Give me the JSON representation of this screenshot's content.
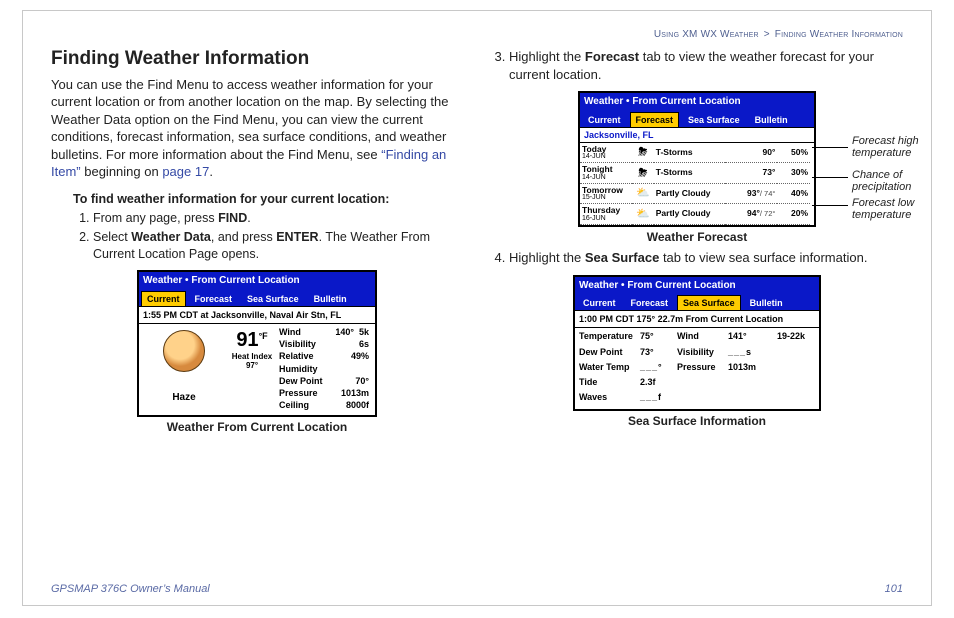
{
  "breadcrumb": {
    "section": "Using XM WX Weather",
    "sep": ">",
    "sub": "Finding Weather Information"
  },
  "heading": "Finding Weather Information",
  "intro_before_link": "You can use the Find Menu to access weather information for your current location or from another location on the map. By selecting the Weather Data option on the Find Menu, you can view the current conditions, forecast information, sea surface conditions, and weather bulletins. For more information about the Find Menu, see ",
  "link_text": "“Finding an Item”",
  "intro_mid": " beginning on ",
  "page_ref": "page 17",
  "intro_after": ".",
  "subhead1": "To find weather information for your current location:",
  "step1_a": "From any page, press ",
  "step1_b": "FIND",
  "step1_c": ".",
  "step2_a": "Select ",
  "step2_b": "Weather Data",
  "step2_c": ", and press ",
  "step2_d": "ENTER",
  "step2_e": ". The Weather From Current Location Page opens.",
  "current": {
    "title": "Weather • From Current Location",
    "tabs": {
      "current": "Current",
      "forecast": "Forecast",
      "sea": "Sea Surface",
      "bulletin": "Bulletin"
    },
    "status": "1:55 PM CDT at Jacksonville, Naval Air Stn, FL",
    "temp": "91",
    "temp_unit": "°F",
    "heat_index_label": "Heat Index",
    "heat_index_value": "97°",
    "condition": "Haze",
    "rows": [
      {
        "label": "Wind",
        "val": "140°",
        "extra": "5k"
      },
      {
        "label": "Visibility",
        "val": "6s",
        "extra": ""
      },
      {
        "label": "Relative Humidity",
        "val": "49%",
        "extra": ""
      },
      {
        "label": "Dew Point",
        "val": "70°",
        "extra": ""
      },
      {
        "label": "Pressure",
        "val": "1013m",
        "extra": ""
      },
      {
        "label": "Ceiling",
        "val": "8000f",
        "extra": ""
      }
    ],
    "caption": "Weather From Current Location"
  },
  "step3_a": "Highlight the ",
  "step3_b": "Forecast",
  "step3_c": " tab to view the weather forecast for your current location.",
  "forecast": {
    "title": "Weather • From Current Location",
    "location": "Jacksonville, FL",
    "rows": [
      {
        "day": "Today",
        "date": "14-JUN",
        "icon": "⛈",
        "cond": "T-Storms",
        "hi": "90°",
        "lo": "",
        "pct": "50%"
      },
      {
        "day": "Tonight",
        "date": "14-JUN",
        "icon": "⛈",
        "cond": "T-Storms",
        "hi": "73°",
        "lo": "",
        "pct": "30%"
      },
      {
        "day": "Tomorrow",
        "date": "15-JUN",
        "icon": "⛅",
        "cond": "Partly Cloudy",
        "hi": "93°",
        "lo": "/ 74°",
        "pct": "40%"
      },
      {
        "day": "Thursday",
        "date": "16-JUN",
        "icon": "⛅",
        "cond": "Partly Cloudy",
        "hi": "94°",
        "lo": "/ 72°",
        "pct": "20%"
      }
    ],
    "caption": "Weather Forecast",
    "callouts": {
      "high": "Forecast high temperature",
      "precip": "Chance of precipitation",
      "low": "Forecast low temperature"
    }
  },
  "step4_a": "Highlight the ",
  "step4_b": "Sea Surface",
  "step4_c": " tab to view sea surface information.",
  "sea": {
    "title": "Weather • From Current Location",
    "status": "1:00 PM CDT  175°  22.7m  From Current Location",
    "rows": {
      "temp_label": "Temperature",
      "temp_val": "75°",
      "wind_label": "Wind",
      "wind_val": "141°",
      "wind_spd": "19-22k",
      "dew_label": "Dew Point",
      "dew_val": "73°",
      "vis_label": "Visibility",
      "vis_val": "___s",
      "wtemp_label": "Water Temp",
      "wtemp_val": "___°",
      "press_label": "Pressure",
      "press_val": "1013m",
      "tide_label": "Tide",
      "tide_val": "2.3f",
      "waves_label": "Waves",
      "waves_val": "___f"
    },
    "caption": "Sea Surface Information"
  },
  "footer": {
    "left": "GPSMAP 376C Owner’s Manual",
    "right": "101"
  }
}
